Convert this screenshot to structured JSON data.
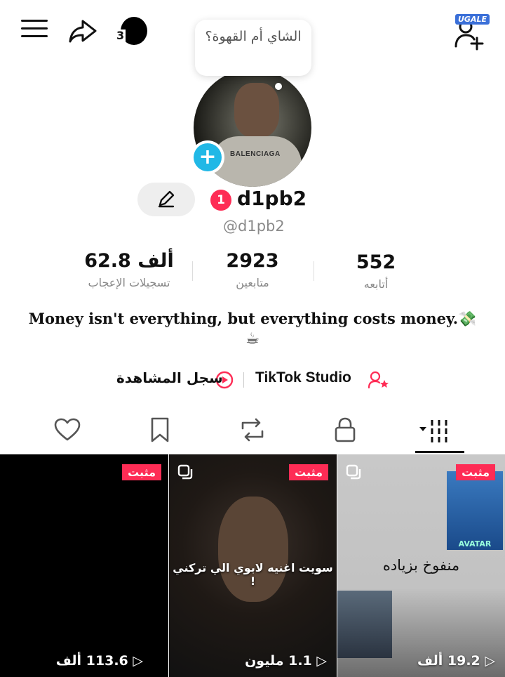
{
  "bubble_text": "الشاي أم القهوة؟",
  "story_count": "3",
  "watermark": "UGALE",
  "notification_count": "1",
  "username": "d1pb2",
  "handle": "@d1pb2",
  "avatar_shirt_text": "BALENCIAGA",
  "stats": [
    {
      "value": "62.8 ألف",
      "label": "تسجيلات الإعجاب"
    },
    {
      "value": "2923",
      "label": "متابعين"
    },
    {
      "value": "552",
      "label": "أتابعه"
    }
  ],
  "bio": {
    "line1": "Money isn't everything, but everything costs money.",
    "money_emoji": "💸",
    "cup_emoji": "☕"
  },
  "links": {
    "studio": "TikTok Studio",
    "history": "سجل المشاهدة"
  },
  "tabs": [
    "videos",
    "private",
    "reposts",
    "favorites",
    "liked"
  ],
  "videos": [
    {
      "pinned": "مثبت",
      "views": "19.2 ألف",
      "caption": "منفوخ بزياده",
      "poster_text": "AVATAR"
    },
    {
      "pinned": "مثبت",
      "views": "1.1 مليون",
      "caption": "سويت اغنيه لابوي الي تركني !"
    },
    {
      "pinned": "مثبت",
      "views": "113.6 ألف"
    }
  ],
  "colors": {
    "accent": "#fe2c55",
    "plus_badge": "#21b8e6"
  }
}
